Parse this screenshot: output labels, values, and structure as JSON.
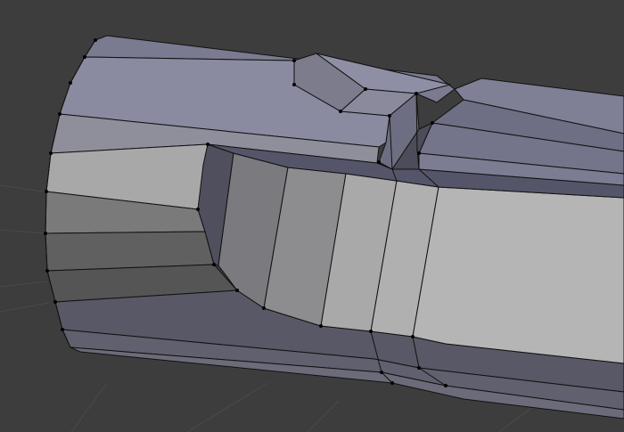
{
  "viewport": {
    "background_color": "#3d3d3d",
    "grid_color": "#4a4a4a",
    "wire_color": "#111111",
    "vertex_color": "#000000"
  },
  "mesh": {
    "selection": "none",
    "shading": "solid",
    "overlay": "wireframe-with-vertices"
  }
}
